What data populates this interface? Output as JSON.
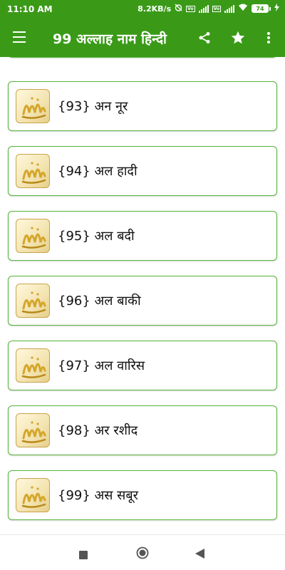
{
  "status": {
    "time": "11:10 AM",
    "speed": "8.2KB/s",
    "battery": "74"
  },
  "appbar": {
    "title": "99 अल्लाह नाम हिन्दी",
    "menu_icon": "hamburger-menu-icon",
    "share_icon": "share-icon",
    "star_icon": "star-icon",
    "more_icon": "more-vert-icon"
  },
  "list": {
    "items": [
      {
        "label": ""
      },
      {
        "label": "{93} अन नूर"
      },
      {
        "label": "{94} अल हादी"
      },
      {
        "label": "{95} अल बदी"
      },
      {
        "label": "{96} अल बाकी"
      },
      {
        "label": "{97} अल वारिस"
      },
      {
        "label": "{98} अर रशीद"
      },
      {
        "label": "{99} अस सबूर"
      }
    ]
  },
  "navbar": {
    "recents_icon": "recents-square-icon",
    "home_icon": "home-circle-icon",
    "back_icon": "back-triangle-icon"
  },
  "colors": {
    "primary": "#3a9a18",
    "card_border": "#55b33a",
    "gold": "#d4a62a"
  }
}
